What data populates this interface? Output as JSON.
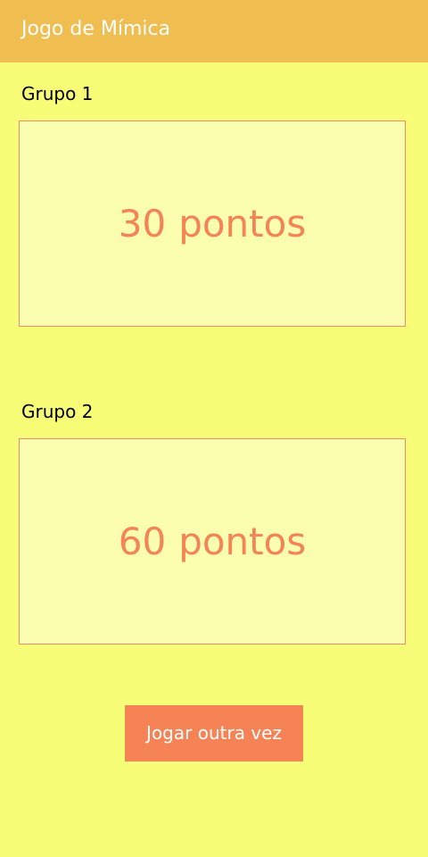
{
  "app_bar": {
    "title": "Jogo de Mímica",
    "background_color": "#f0bd50"
  },
  "groups": [
    {
      "label": "Grupo 1",
      "score": "30",
      "unit": "pontos"
    },
    {
      "label": "Grupo 2",
      "score": "60",
      "unit": "pontos"
    }
  ],
  "actions": {
    "play_again_label": "Jogar outra vez"
  },
  "colors": {
    "page_background": "#f8fd78",
    "score_box_background": "#fafeae",
    "accent": "#f58355"
  }
}
